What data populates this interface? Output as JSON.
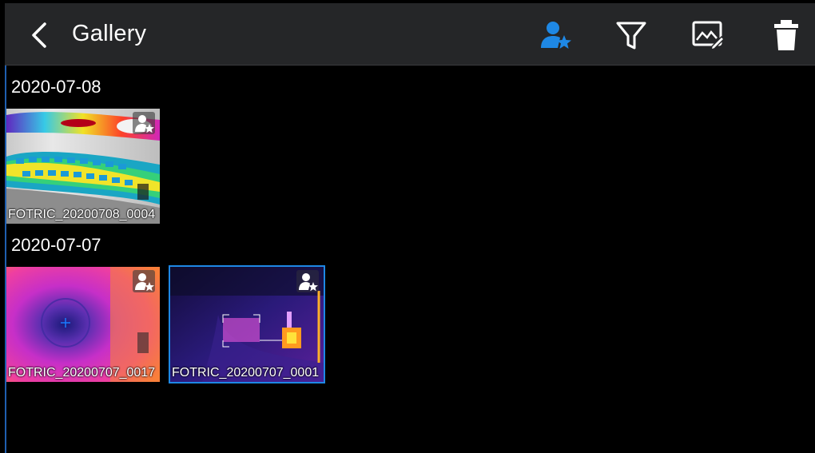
{
  "header": {
    "title": "Gallery"
  },
  "toolbar": {
    "icons": [
      "favorite-user-icon",
      "filter-icon",
      "edit-image-icon",
      "delete-icon"
    ],
    "accent": "#1e88e5"
  },
  "groups": [
    {
      "date": "2020-07-08",
      "items": [
        {
          "caption": "FOTRIC_20200708_0004",
          "selected": false
        }
      ]
    },
    {
      "date": "2020-07-07",
      "items": [
        {
          "caption": "FOTRIC_20200707_0017",
          "selected": false
        },
        {
          "caption": "FOTRIC_20200707_0001",
          "selected": true
        }
      ]
    }
  ]
}
